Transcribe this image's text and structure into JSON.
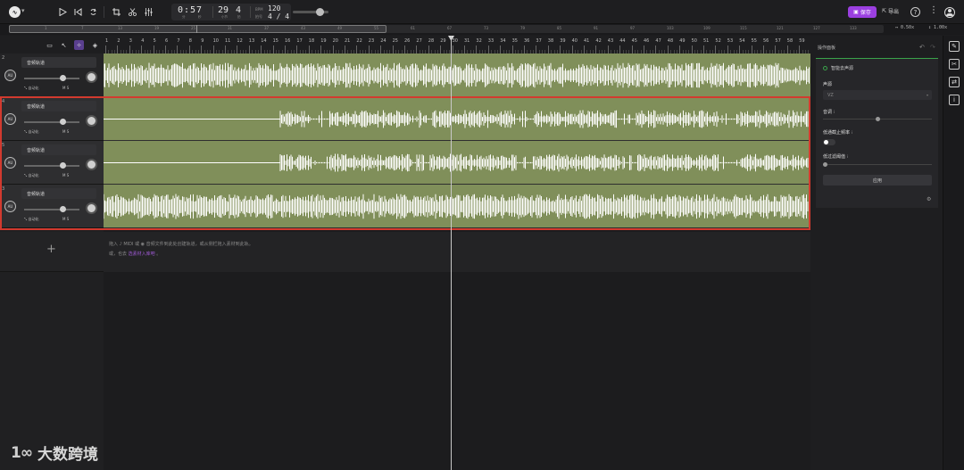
{
  "topbar": {
    "logo_label": "∿",
    "time": "0:57",
    "time_sub_min": "分",
    "time_sub_sec": "秒",
    "bars": "29",
    "beat": "4",
    "bars_lbl": "小节",
    "beat_lbl": "拍",
    "bpm_lbl": "BPM",
    "bpm": "120",
    "sig_lbl": "拍号",
    "signature": "4 / 4",
    "save_label": "保存",
    "export_label": "导出",
    "help_label": "?",
    "more_label": "⋮"
  },
  "overview": {
    "ticks": [
      "1",
      "7",
      "13",
      "19",
      "25",
      "31",
      "37",
      "43",
      "49",
      "55",
      "61",
      "67",
      "73",
      "79",
      "85",
      "91",
      "97",
      "103",
      "109",
      "115",
      "121",
      "127",
      "133"
    ],
    "zoom_h": "0.50x",
    "zoom_v": "1.00x"
  },
  "ruler": {
    "numbers": [
      "1",
      "2",
      "3",
      "4",
      "5",
      "6",
      "7",
      "8",
      "9",
      "10",
      "11",
      "12",
      "13",
      "14",
      "15",
      "16",
      "17",
      "18",
      "19",
      "20",
      "21",
      "22",
      "23",
      "24",
      "25",
      "26",
      "27",
      "28",
      "29",
      "30",
      "31",
      "32",
      "33",
      "34",
      "35",
      "36",
      "37",
      "38",
      "39",
      "40",
      "41",
      "42",
      "43",
      "44",
      "45",
      "46",
      "47",
      "48",
      "49",
      "50",
      "51",
      "52",
      "53",
      "54",
      "55",
      "56",
      "57",
      "58",
      "59"
    ]
  },
  "tracks": [
    {
      "num": "2",
      "name": "音频轨道",
      "auto": "自动化",
      "ms": "M S",
      "icon": "AU"
    },
    {
      "num": "4",
      "name": "音频轨道",
      "auto": "自动化",
      "ms": "M S",
      "icon": "AU"
    },
    {
      "num": "5",
      "name": "音频轨道",
      "auto": "自动化",
      "ms": "M S",
      "icon": "AU"
    },
    {
      "num": "3",
      "name": "音频轨道",
      "auto": "自动化",
      "ms": "M S",
      "icon": "AU"
    }
  ],
  "add_track": "+",
  "hint": {
    "line1": "拖入 ♪ MIDI 或 ◉ 音频文件到此处创建轨道，或从侧栏拖入素材到此轨。",
    "line2_prefix": "或，也去",
    "line2_link": "选素材入库吧",
    "line2_suffix": "。"
  },
  "panel": {
    "title": "操作面板",
    "undo": "↶",
    "redo": "↷",
    "card_title": "智能去声源",
    "voice_label": "声源",
    "voice_value": "VZ",
    "pitch_label": "音调",
    "info": "i",
    "lowpass_label": "低通截止频率",
    "lowgain_label": "低过滤阈值",
    "apply_label": "应用",
    "gear": "⚙"
  },
  "rail": {
    "icons": [
      "✎",
      "✂",
      "⇄",
      "i"
    ]
  },
  "watermark": {
    "logo": "1∞",
    "text": "大数跨境"
  },
  "colors": {
    "accent": "#9b3fe0",
    "lane": "#808f5a",
    "selection": "#d23a2f",
    "active_green": "#3aa34a"
  }
}
